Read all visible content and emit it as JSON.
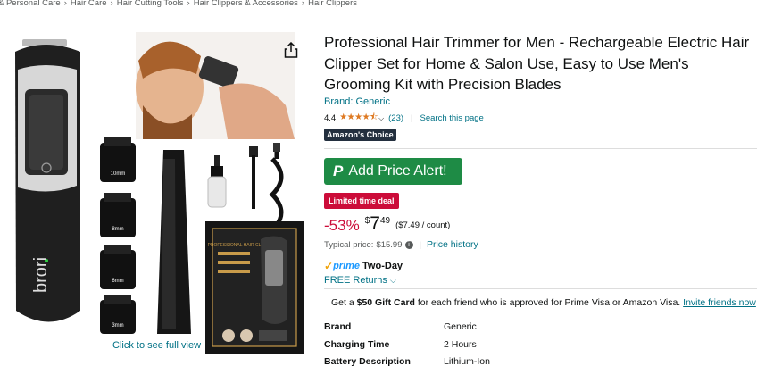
{
  "breadcrumb": [
    "& Personal Care",
    "Hair Care",
    "Hair Cutting Tools",
    "Hair Clippers & Accessories",
    "Hair Clippers"
  ],
  "breadcrumb_separator": "›",
  "gallery": {
    "device_brand": "brori",
    "guard_labels": [
      "10mm",
      "8mm",
      "6mm",
      "3mm"
    ],
    "box_label": "PROFESSIONAL HAIR CLIPPER",
    "full_view_link": "Click to see full view"
  },
  "product": {
    "title": "Professional Hair Trimmer for Men - Rechargeable Electric Hair Clipper Set for Home & Salon Use, Easy to Use Men's Grooming Kit with Precision Blades",
    "brand_link": "Brand: Generic",
    "rating": "4.4",
    "stars": "★★★★⯪",
    "rating_count": "(23)",
    "search_link": "Search this page",
    "badge": "Amazon's Choice"
  },
  "alert_button": "Add Price Alert!",
  "deal_badge": "Limited time deal",
  "price": {
    "discount": "-53%",
    "currency": "$",
    "whole": "7",
    "fraction": "49",
    "unit_price": "($7.49 / count)",
    "typical_label": "Typical price:",
    "typical_value": "$15.99",
    "history_link": "Price history"
  },
  "delivery": {
    "prime_word": "prime",
    "two_day": "Two-Day",
    "returns_link": "FREE Returns"
  },
  "gift": {
    "pre": "Get a ",
    "bold": "$50 Gift Card",
    "post": " for each friend who is approved for Prime Visa or Amazon Visa. ",
    "link": "Invite friends now"
  },
  "specs": [
    {
      "key": "Brand",
      "value": "Generic"
    },
    {
      "key": "Charging Time",
      "value": "2 Hours"
    },
    {
      "key": "Battery Description",
      "value": "Lithium-Ion"
    }
  ],
  "colors": {
    "link": "#007185",
    "deal": "#cc0c39",
    "alert_green": "#1e8b45",
    "choice_bg": "#232f3e",
    "star": "#de7921"
  }
}
